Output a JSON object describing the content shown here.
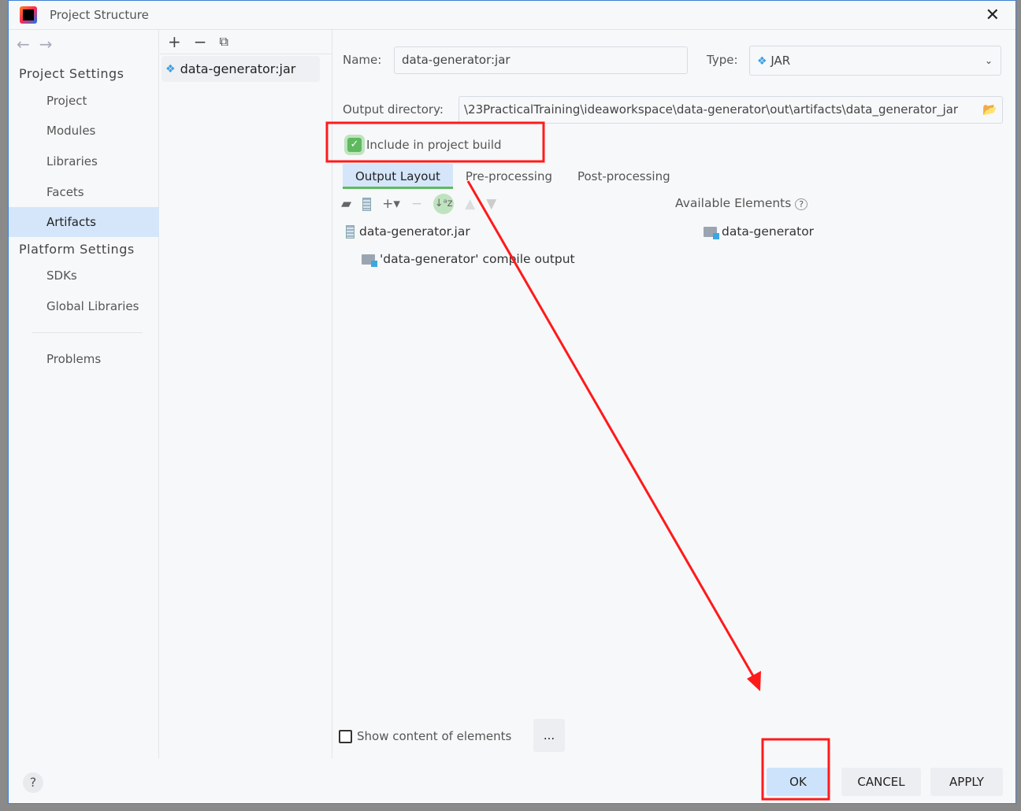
{
  "window": {
    "title": "Project Structure"
  },
  "sidebar": {
    "project_settings": "Project Settings",
    "items": [
      {
        "label": "Project"
      },
      {
        "label": "Modules"
      },
      {
        "label": "Libraries"
      },
      {
        "label": "Facets"
      },
      {
        "label": "Artifacts",
        "selected": true
      }
    ],
    "platform_settings": "Platform Settings",
    "platform_items": [
      {
        "label": "SDKs"
      },
      {
        "label": "Global Libraries"
      }
    ],
    "problems": "Problems"
  },
  "artifacts_list": {
    "items": [
      {
        "label": "data-generator:jar",
        "icon": "artifact-icon"
      }
    ]
  },
  "form": {
    "name_label": "Name:",
    "name_value": "data-generator:jar",
    "type_label": "Type:",
    "type_value": "JAR",
    "output_dir_label": "Output directory:",
    "output_dir_value": "\\23PracticalTraining\\ideaworkspace\\data-generator\\out\\artifacts\\data_generator_jar",
    "include_build": "Include in project build",
    "include_build_checked": true
  },
  "tabs": [
    {
      "label": "Output Layout",
      "active": true
    },
    {
      "label": "Pre-processing"
    },
    {
      "label": "Post-processing"
    }
  ],
  "layout": {
    "tree": [
      {
        "label": "data-generator.jar"
      },
      {
        "label": "'data-generator' compile output"
      }
    ],
    "available_label": "Available Elements",
    "available": [
      {
        "label": "data-generator"
      }
    ],
    "show_content": "Show content of elements",
    "show_content_checked": false,
    "ellipsis": "..."
  },
  "buttons": {
    "ok": "OK",
    "cancel": "CANCEL",
    "apply": "APPLY",
    "help": "?"
  },
  "colors": {
    "annotation": "#ff1a1a",
    "selection": "#d5e6fa",
    "accent_green": "#5fb95f"
  }
}
